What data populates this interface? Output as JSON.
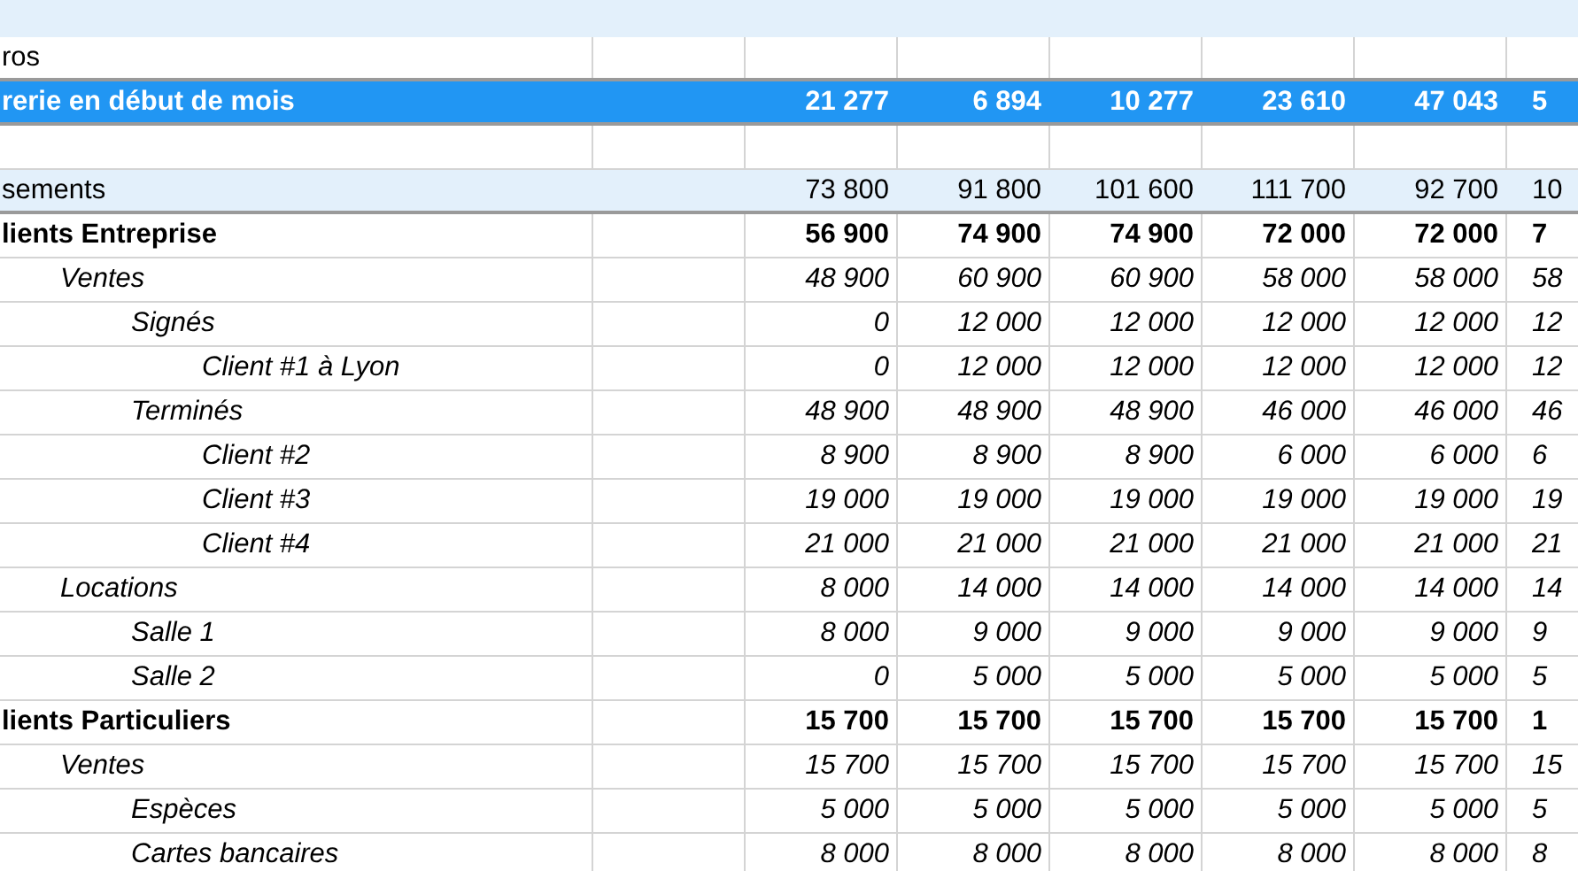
{
  "rows": [
    {
      "kind": "note",
      "label": "ros"
    },
    {
      "kind": "balance",
      "label": "rerie en début de mois",
      "values": [
        "21 277",
        "6 894",
        "10 277",
        "23 610",
        "47 043",
        "5"
      ]
    },
    {
      "kind": "spacer"
    },
    {
      "kind": "total",
      "label": "sements",
      "values": [
        "73 800",
        "91 800",
        "101 600",
        "111 700",
        "92 700",
        "10"
      ]
    },
    {
      "kind": "group",
      "label": "lients Entreprise",
      "values": [
        "56 900",
        "74 900",
        "74 900",
        "72 000",
        "72 000",
        "7"
      ],
      "children": [
        {
          "label": "Ventes",
          "values": [
            "48 900",
            "60 900",
            "60 900",
            "58 000",
            "58 000",
            "58"
          ],
          "children": [
            {
              "label": "Signés",
              "values": [
                "0",
                "12 000",
                "12 000",
                "12 000",
                "12 000",
                "12"
              ],
              "children": [
                {
                  "label": "Client #1 à Lyon",
                  "values": [
                    "0",
                    "12 000",
                    "12 000",
                    "12 000",
                    "12 000",
                    "12"
                  ]
                }
              ]
            },
            {
              "label": "Terminés",
              "values": [
                "48 900",
                "48 900",
                "48 900",
                "46 000",
                "46 000",
                "46"
              ],
              "children": [
                {
                  "label": "Client #2",
                  "values": [
                    "8 900",
                    "8 900",
                    "8 900",
                    "6 000",
                    "6 000",
                    "6"
                  ]
                },
                {
                  "label": "Client #3",
                  "values": [
                    "19 000",
                    "19 000",
                    "19 000",
                    "19 000",
                    "19 000",
                    "19"
                  ]
                },
                {
                  "label": "Client #4",
                  "values": [
                    "21 000",
                    "21 000",
                    "21 000",
                    "21 000",
                    "21 000",
                    "21"
                  ]
                }
              ]
            }
          ]
        },
        {
          "label": "Locations",
          "values": [
            "8 000",
            "14 000",
            "14 000",
            "14 000",
            "14 000",
            "14"
          ],
          "children": [
            {
              "label": "Salle 1",
              "values": [
                "8 000",
                "9 000",
                "9 000",
                "9 000",
                "9 000",
                "9"
              ]
            },
            {
              "label": "Salle 2",
              "values": [
                "0",
                "5 000",
                "5 000",
                "5 000",
                "5 000",
                "5"
              ]
            }
          ]
        }
      ]
    },
    {
      "kind": "group",
      "label": "lients Particuliers",
      "values": [
        "15 700",
        "15 700",
        "15 700",
        "15 700",
        "15 700",
        "1"
      ],
      "children": [
        {
          "label": "Ventes",
          "values": [
            "15 700",
            "15 700",
            "15 700",
            "15 700",
            "15 700",
            "15"
          ],
          "children": [
            {
              "label": "Espèces",
              "values": [
                "5 000",
                "5 000",
                "5 000",
                "5 000",
                "5 000",
                "5"
              ]
            },
            {
              "label": "Cartes bancaires",
              "values": [
                "8 000",
                "8 000",
                "8 000",
                "8 000",
                "8 000",
                "8"
              ]
            }
          ]
        }
      ]
    }
  ]
}
